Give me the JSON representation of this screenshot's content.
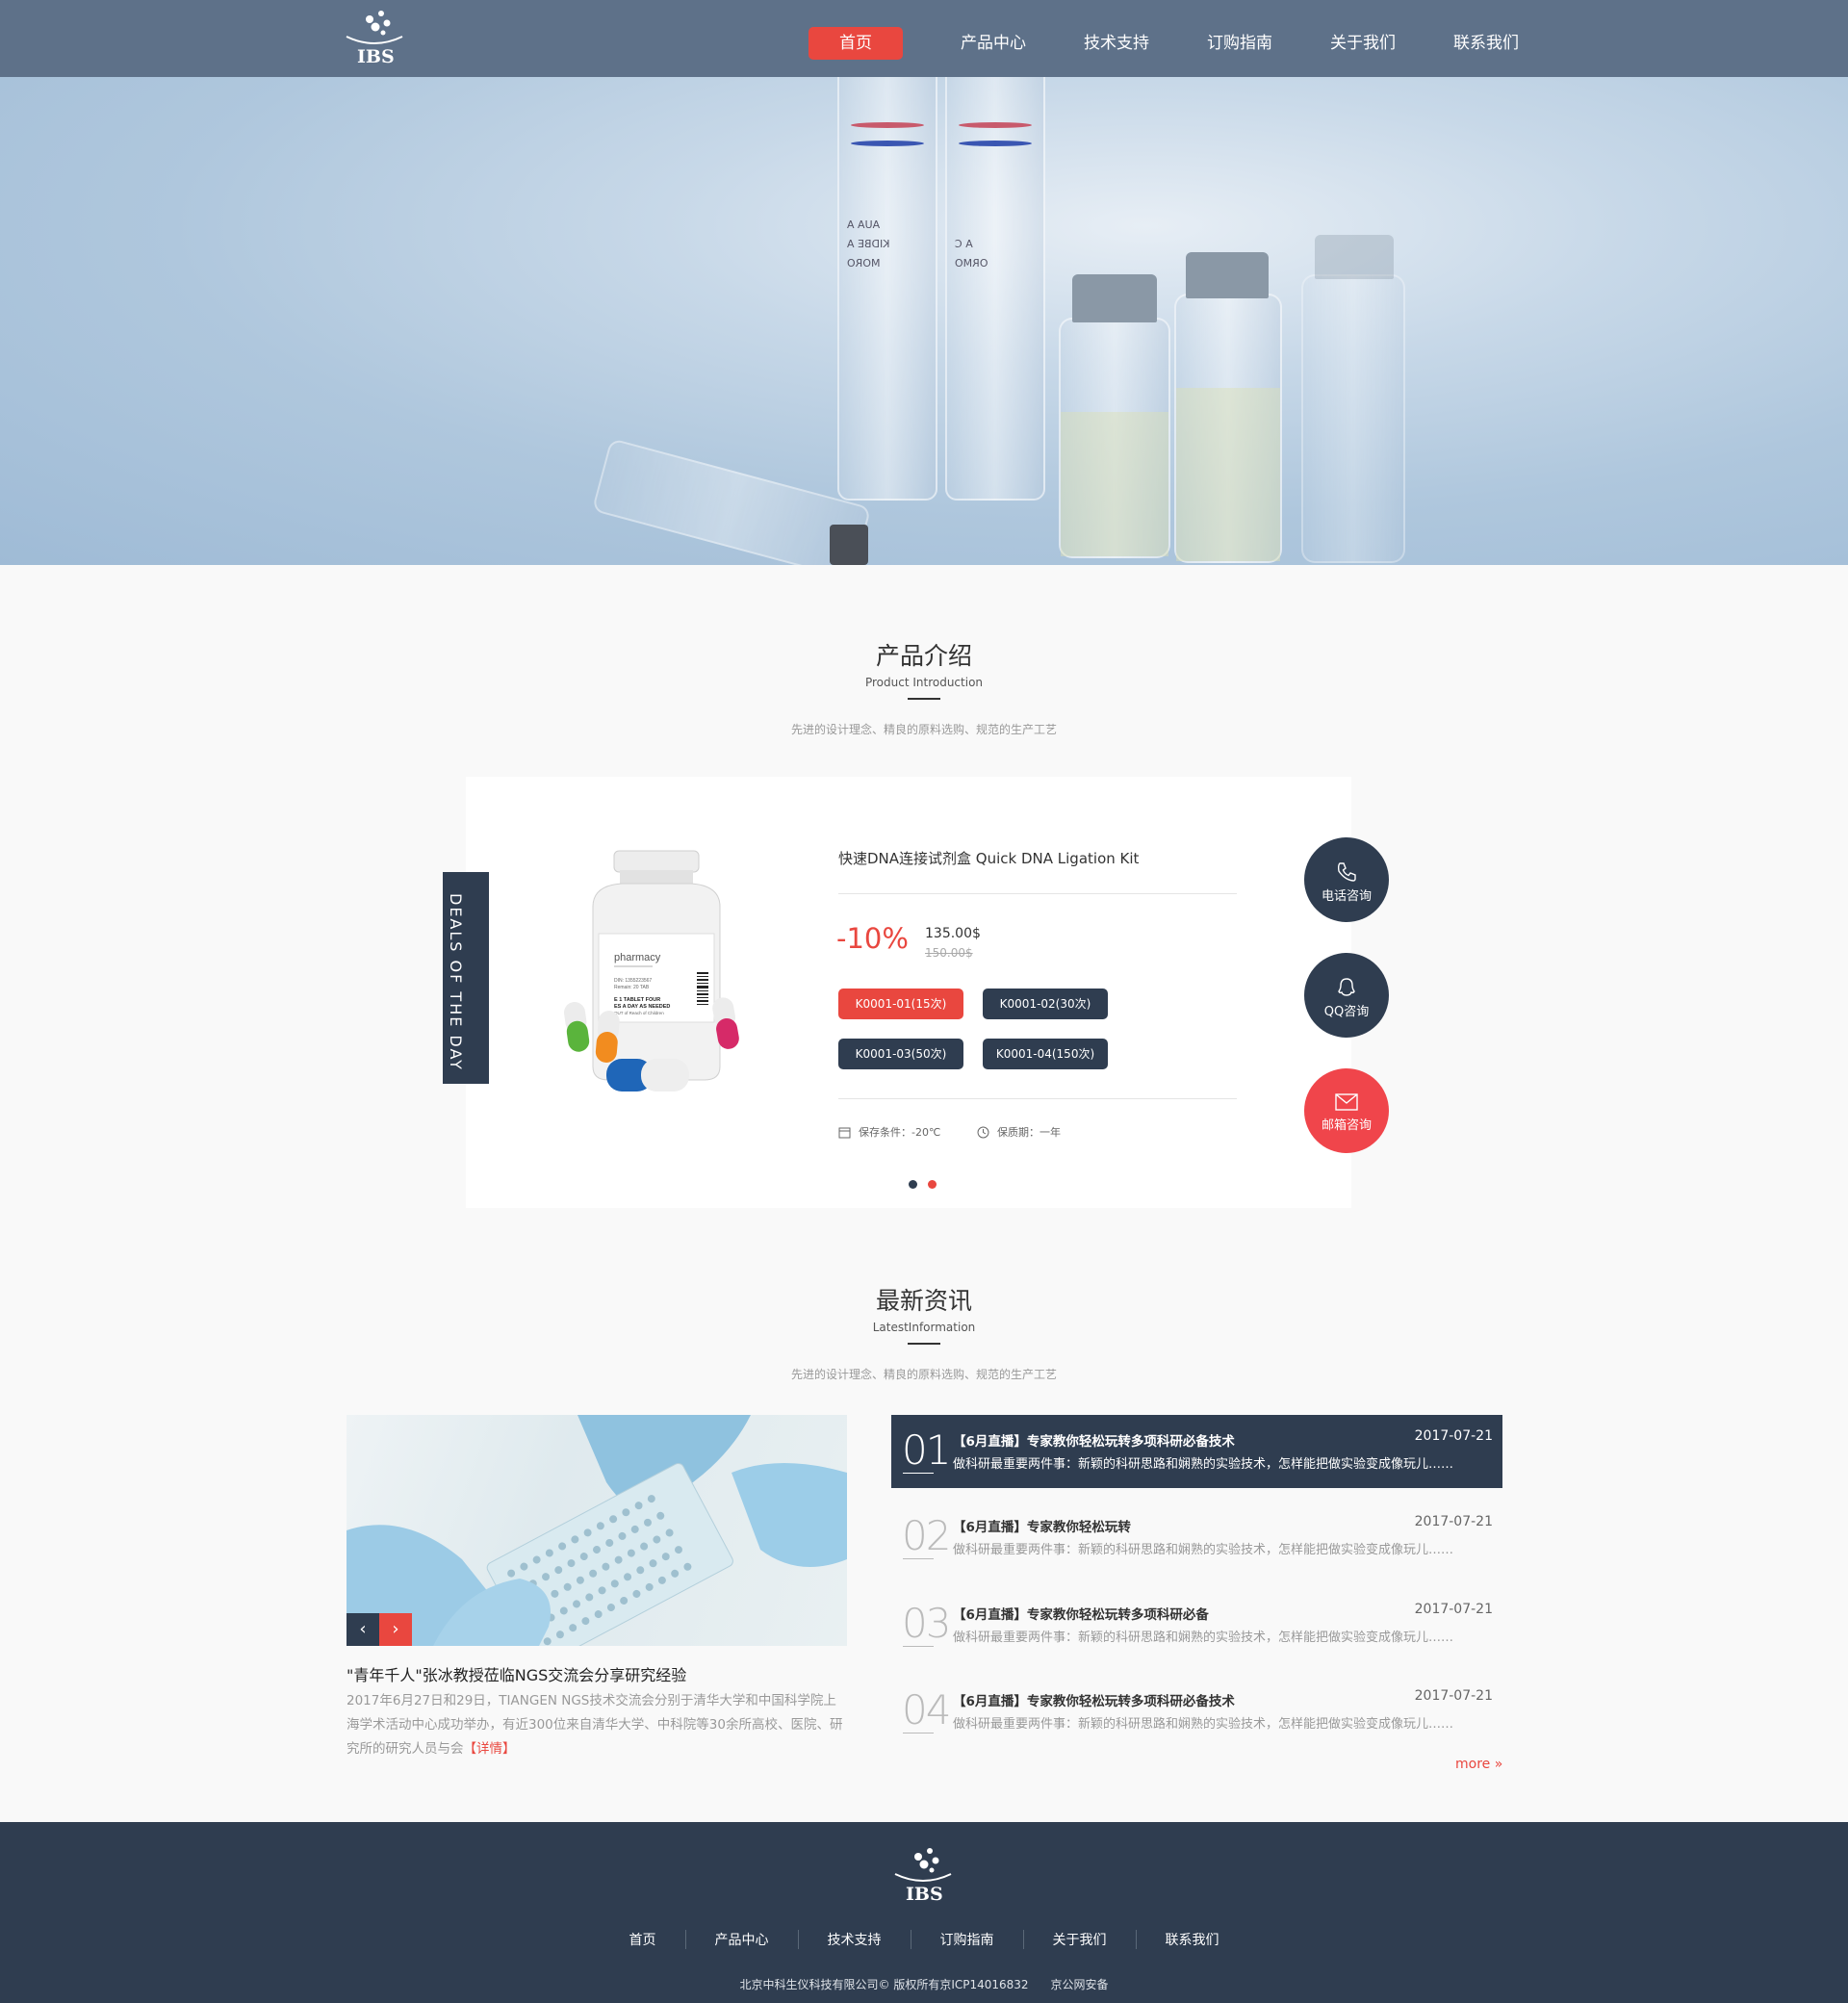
{
  "brand": {
    "logo_text": "IBS"
  },
  "nav": {
    "items": [
      "首页",
      "产品中心",
      "技术支持",
      "订购指南",
      "关于我们",
      "联系我们"
    ],
    "active": "首页"
  },
  "colors": {
    "accent": "#e9473f",
    "dark": "#2f3d50",
    "nav_bg": "#5e7189"
  },
  "product_section": {
    "title": "产品介绍",
    "subtitle_en": "Product Introduction",
    "tagline": "先进的设计理念、精良的原料选购、规范的生产工艺"
  },
  "product": {
    "badge": "DEALS OF THE DAY",
    "name": "快速DNA连接试剂盒 Quick DNA Ligation Kit",
    "discount": "-10%",
    "price": "135.00$",
    "old_price": "150.00$",
    "options": [
      "K0001-01(15次)",
      "K0001-02(30次)",
      "K0001-03(50次)",
      "K0001-04(150次)"
    ],
    "selected_option": "K0001-01(15次)",
    "storage_label": "保存条件：-20℃",
    "shelf_life_label": "保质期：一年",
    "bottle_label": "pharmacy",
    "bottle_lines": [
      "DIN: 1355223567",
      "Remain: 20 TAB",
      "E 1 TABLET FOUR",
      "ES A DAY AS NEEDED",
      "OUT of Reach of Children"
    ],
    "carousel_pages": 2,
    "carousel_active": 1
  },
  "contact": {
    "phone": "电话咨询",
    "qq": "QQ咨询",
    "email": "邮箱咨询"
  },
  "news_section": {
    "title": "最新资讯",
    "subtitle_en": "LatestInformation",
    "tagline": "先进的设计理念、精良的原料选购、规范的生产工艺"
  },
  "featured_news": {
    "title": "\"青年千人\"张冰教授莅临NGS交流会分享研究经验",
    "body": "2017年6月27日和29日，TIANGEN   NGS技术交流会分别于清华大学和中国科学院上海学术活动中心成功举办，有近300位来自清华大学、中科院等30余所高校、医院、研究所的研究人员与会",
    "more": "【详情】",
    "prev": "‹",
    "next": "›"
  },
  "news_list": [
    {
      "num": "01",
      "title": "【6月直播】专家教你轻松玩转多项科研必备技术",
      "desc": "做科研最重要两件事：新颖的科研思路和娴熟的实验技术，怎样能把做实验变成像玩儿……",
      "date": "2017-07-21"
    },
    {
      "num": "02",
      "title": "【6月直播】专家教你轻松玩转",
      "desc": "做科研最重要两件事：新颖的科研思路和娴熟的实验技术，怎样能把做实验变成像玩儿……",
      "date": "2017-07-21"
    },
    {
      "num": "03",
      "title": "【6月直播】专家教你轻松玩转多项科研必备",
      "desc": "做科研最重要两件事：新颖的科研思路和娴熟的实验技术，怎样能把做实验变成像玩儿……",
      "date": "2017-07-21"
    },
    {
      "num": "04",
      "title": "【6月直播】专家教你轻松玩转多项科研必备技术",
      "desc": "做科研最重要两件事：新颖的科研思路和娴熟的实验技术，怎样能把做实验变成像玩儿……",
      "date": "2017-07-21"
    }
  ],
  "news_more": "more »",
  "footer": {
    "nav": [
      "首页",
      "产品中心",
      "技术支持",
      "订购指南",
      "关于我们",
      "联系我们"
    ],
    "copyright": "北京中科生仪科技有限公司© 版权所有京ICP14016832",
    "security": "京公网安备"
  },
  "hero": {
    "ampoule_labels": [
      "AUA A",
      "KIDBE A",
      "MORO",
      "A C",
      "ORMO"
    ]
  }
}
